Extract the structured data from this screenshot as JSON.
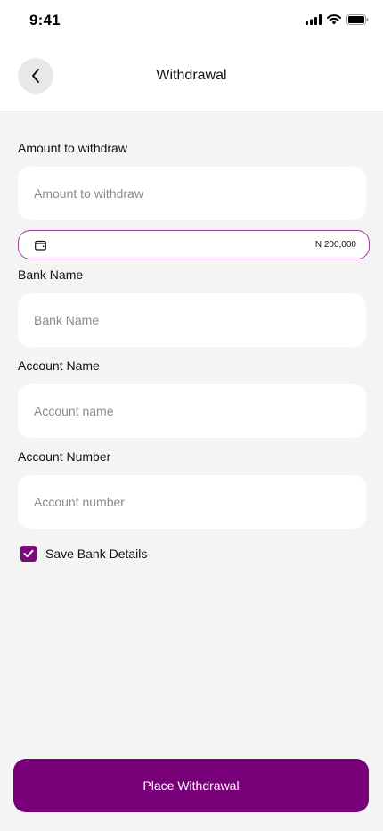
{
  "status_bar": {
    "time": "9:41",
    "icons": [
      "cellular-signal-icon",
      "wifi-icon",
      "battery-icon"
    ]
  },
  "header": {
    "title": "Withdrawal",
    "back_icon": "chevron-left-icon"
  },
  "form": {
    "amount": {
      "label": "Amount to withdraw",
      "placeholder": "Amount to withdraw",
      "value": ""
    },
    "balance": {
      "icon": "wallet-icon",
      "value": "N 200,000"
    },
    "bank_name": {
      "label": "Bank Name",
      "placeholder": "Bank Name",
      "value": ""
    },
    "account_name": {
      "label": "Account Name",
      "placeholder": "Account name",
      "value": ""
    },
    "account_number": {
      "label": "Account Number",
      "placeholder": "Account number",
      "value": ""
    },
    "save_details": {
      "label": "Save Bank Details",
      "checked": true,
      "icon": "checkmark-icon"
    }
  },
  "actions": {
    "submit_label": "Place Withdrawal"
  },
  "colors": {
    "brand": "#780078",
    "balance_border": "#9b3f98",
    "background": "#f4f4f4",
    "input_bg": "#ffffff"
  }
}
